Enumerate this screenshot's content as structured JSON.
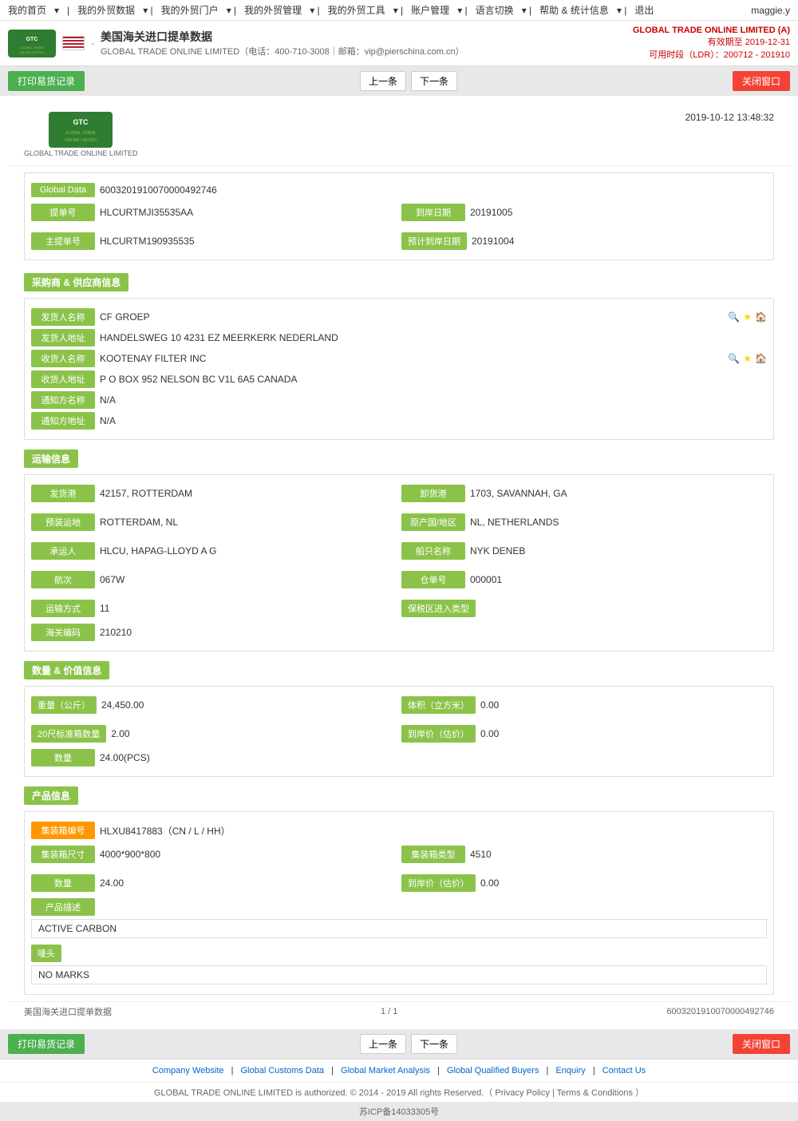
{
  "topnav": {
    "items": [
      "我的首页",
      "我的外贸数据",
      "我的外贸门户",
      "我的外贸管理",
      "我的外贸工具",
      "账户管理",
      "语言切换",
      "帮助 & 统计信息",
      "退出"
    ],
    "user": "maggie.y"
  },
  "header": {
    "title": "美国海关进口提单数据",
    "subtitle": "GLOBAL TRADE ONLINE LIMITED（电话：400-710-3008｜邮箱：vip@pierschina.com.cn）",
    "company": "GLOBAL TRADE ONLINE LIMITED (A)",
    "valid_until": "有效期至 2019-12-31",
    "ldr": "可用时段（LDR）：200712 - 201910"
  },
  "toolbar": {
    "print_label": "打印易货记录",
    "prev_label": "上一条",
    "next_label": "下一条",
    "close_label": "关闭窗口"
  },
  "document": {
    "timestamp": "2019-10-12  13:48:32",
    "logo_sub": "GLOBAL TRADE ONLINE LIMITED",
    "global_data_label": "Global Data",
    "global_data_value": "6003201910070000492746",
    "bill_no_label": "提单号",
    "bill_no_value": "HLCURTMJI35535AA",
    "arrival_date_label": "到岸日期",
    "arrival_date_value": "20191005",
    "master_bill_label": "主提单号",
    "master_bill_value": "HLCURTM190935535",
    "est_arrival_label": "预计到岸日期",
    "est_arrival_value": "20191004"
  },
  "shipper": {
    "section_label": "采购商 & 供应商信息",
    "sender_name_label": "发货人名称",
    "sender_name_value": "CF GROEP",
    "sender_addr_label": "发货人地址",
    "sender_addr_value": "HANDELSWEG 10 4231 EZ MEERKERK NEDERLAND",
    "receiver_name_label": "收货人名称",
    "receiver_name_value": "KOOTENAY FILTER INC",
    "receiver_addr_label": "收货人地址",
    "receiver_addr_value": "P O BOX 952 NELSON BC V1L 6A5 CANADA",
    "notify_name_label": "通知方名称",
    "notify_name_value": "N/A",
    "notify_addr_label": "通知方地址",
    "notify_addr_value": "N/A"
  },
  "transport": {
    "section_label": "运输信息",
    "origin_port_label": "发货港",
    "origin_port_value": "42157, ROTTERDAM",
    "dest_port_label": "卸货港",
    "dest_port_value": "1703, SAVANNAH, GA",
    "pre_transport_label": "预装运地",
    "pre_transport_value": "ROTTERDAM, NL",
    "origin_country_label": "原产国/地区",
    "origin_country_value": "NL, NETHERLANDS",
    "carrier_label": "承运人",
    "carrier_value": "HLCU, HAPAG-LLOYD A G",
    "vessel_label": "船只名称",
    "vessel_value": "NYK DENEB",
    "voyage_label": "航次",
    "voyage_value": "067W",
    "warehouse_label": "仓单号",
    "warehouse_value": "000001",
    "transport_mode_label": "运输方式",
    "transport_mode_value": "11",
    "bonded_label": "保税区进入类型",
    "bonded_value": "",
    "customs_label": "海关编码",
    "customs_value": "210210"
  },
  "quantity": {
    "section_label": "数量 & 价值信息",
    "weight_label": "重量（公斤）",
    "weight_value": "24,450.00",
    "volume_label": "体积（立方米）",
    "volume_value": "0.00",
    "container20_label": "20尺标准箱数量",
    "container20_value": "2.00",
    "fob_label": "到岸价（估价）",
    "fob_value": "0.00",
    "quantity_label": "数量",
    "quantity_value": "24.00(PCS)"
  },
  "product": {
    "section_label": "产品信息",
    "container_no_label": "集装箱编号",
    "container_no_value": "HLXU8417883（CN / L / HH）",
    "container_size_label": "集装箱尺寸",
    "container_size_value": "4000*900*800",
    "container_type_label": "集装箱类型",
    "container_type_value": "4510",
    "quantity_label": "数量",
    "quantity_value": "24.00",
    "fob_label": "到岸价（估价）",
    "fob_value": "0.00",
    "desc_label": "产品描述",
    "desc_value": "ACTIVE CARBON",
    "marks_label": "唛头",
    "marks_value": "NO MARKS"
  },
  "docfooter": {
    "source": "美国海关进口提单数据",
    "page": "1 / 1",
    "record_no": "6003201910070000492746"
  },
  "footer": {
    "links": [
      "Company Website",
      "Global Customs Data",
      "Global Market Analysis",
      "Global Qualified Buyers",
      "Enquiry",
      "Contact Us"
    ],
    "copyright": "GLOBAL TRADE ONLINE LIMITED is authorized. © 2014 - 2019 All rights Reserved.（",
    "privacy": "Privacy Policy",
    "separator": "|",
    "terms": "Terms & Conditions",
    "close_paren": "）",
    "icp": "苏ICP备14033305号"
  }
}
